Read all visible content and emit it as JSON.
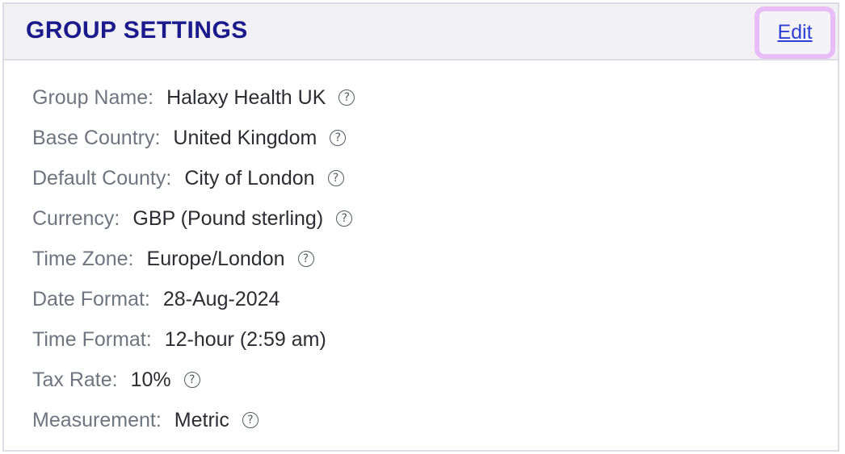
{
  "header": {
    "title": "GROUP SETTINGS",
    "edit_label": "Edit"
  },
  "settings": [
    {
      "label": "Group Name:",
      "value": "Halaxy Health UK",
      "help_icon": "question-circle-icon"
    },
    {
      "label": "Base Country:",
      "value": "United Kingdom",
      "help_icon": "question-circle-icon"
    },
    {
      "label": "Default County:",
      "value": "City of London",
      "help_icon": "question-circle-icon"
    },
    {
      "label": "Currency:",
      "value": "GBP (Pound sterling)",
      "help_icon": "question-circle-icon"
    },
    {
      "label": "Time Zone:",
      "value": "Europe/London",
      "help_icon": "question-circle-icon"
    },
    {
      "label": "Date Format:",
      "value": "28-Aug-2024"
    },
    {
      "label": "Time Format:",
      "value": "12-hour (2:59 am)"
    },
    {
      "label": "Tax Rate:",
      "value": "10%",
      "help_icon": "question-circle-icon"
    },
    {
      "label": "Measurement:",
      "value": "Metric",
      "help_icon": "question-circle-icon"
    }
  ],
  "colors": {
    "title": "#1a1a8c",
    "link": "#2f3fd6",
    "highlight": "#e8bdf7",
    "header_bg": "#f0f0f5"
  }
}
